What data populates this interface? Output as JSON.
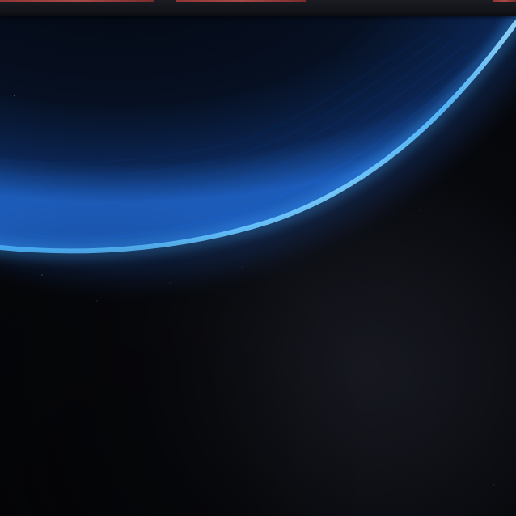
{
  "scene": {
    "subject": "planet-horizon",
    "colors": {
      "space": "#06070a",
      "planet_dark": "#071120",
      "planet_mid": "#0d2a5a",
      "limb_glow": "#3fa9ff",
      "limb_highlight": "#b8ecff",
      "top_strip": "#14161b",
      "top_accent": "#c05050"
    }
  }
}
